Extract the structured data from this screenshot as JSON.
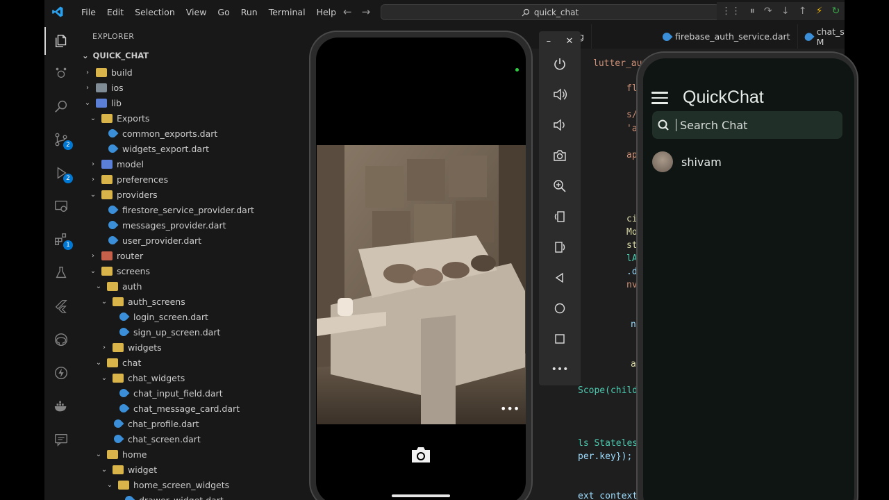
{
  "titlebar": {
    "menu": [
      "File",
      "Edit",
      "Selection",
      "View",
      "Go",
      "Run",
      "Terminal",
      "Help"
    ],
    "command_center": "quick_chat"
  },
  "activity": {
    "scm_badge": "2",
    "debug_badge": "2",
    "extensions_badge": "1"
  },
  "explorer": {
    "title": "EXPLORER",
    "project": "QUICK_CHAT",
    "items": [
      {
        "label": "build",
        "depth": 0,
        "type": "folder",
        "open": false,
        "color": "#d9b44a"
      },
      {
        "label": "ios",
        "depth": 0,
        "type": "folder",
        "open": false,
        "color": "#7f8b95"
      },
      {
        "label": "lib",
        "depth": 0,
        "type": "folder",
        "open": true,
        "color": "#5b7fd6"
      },
      {
        "label": "Exports",
        "depth": 1,
        "type": "folder",
        "open": true,
        "color": "#d9b44a"
      },
      {
        "label": "common_exports.dart",
        "depth": 2,
        "type": "dart"
      },
      {
        "label": "widgets_export.dart",
        "depth": 2,
        "type": "dart"
      },
      {
        "label": "model",
        "depth": 1,
        "type": "folder",
        "open": false,
        "color": "#5b7fd6"
      },
      {
        "label": "preferences",
        "depth": 1,
        "type": "folder",
        "open": false,
        "color": "#d9b44a"
      },
      {
        "label": "providers",
        "depth": 1,
        "type": "folder",
        "open": true,
        "color": "#d9b44a"
      },
      {
        "label": "firestore_service_provider.dart",
        "depth": 2,
        "type": "dart"
      },
      {
        "label": "messages_provider.dart",
        "depth": 2,
        "type": "dart"
      },
      {
        "label": "user_provider.dart",
        "depth": 2,
        "type": "dart"
      },
      {
        "label": "router",
        "depth": 1,
        "type": "folder",
        "open": false,
        "color": "#c5604a"
      },
      {
        "label": "screens",
        "depth": 1,
        "type": "folder",
        "open": true,
        "color": "#d9b44a"
      },
      {
        "label": "auth",
        "depth": 2,
        "type": "folder",
        "open": true,
        "color": "#d9b44a"
      },
      {
        "label": "auth_screens",
        "depth": 3,
        "type": "folder",
        "open": true,
        "color": "#d9b44a"
      },
      {
        "label": "login_screen.dart",
        "depth": 4,
        "type": "dart"
      },
      {
        "label": "sign_up_screen.dart",
        "depth": 4,
        "type": "dart"
      },
      {
        "label": "widgets",
        "depth": 3,
        "type": "folder",
        "open": false,
        "color": "#d9b44a"
      },
      {
        "label": "chat",
        "depth": 2,
        "type": "folder",
        "open": true,
        "color": "#d9b44a"
      },
      {
        "label": "chat_widgets",
        "depth": 3,
        "type": "folder",
        "open": true,
        "color": "#d9b44a"
      },
      {
        "label": "chat_input_field.dart",
        "depth": 4,
        "type": "dart"
      },
      {
        "label": "chat_message_card.dart",
        "depth": 4,
        "type": "dart"
      },
      {
        "label": "chat_profile.dart",
        "depth": 3,
        "type": "dart"
      },
      {
        "label": "chat_screen.dart",
        "depth": 3,
        "type": "dart"
      },
      {
        "label": "home",
        "depth": 2,
        "type": "folder",
        "open": true,
        "color": "#d9b44a"
      },
      {
        "label": "widget",
        "depth": 3,
        "type": "folder",
        "open": true,
        "color": "#d9b44a"
      },
      {
        "label": "home_screen_widgets",
        "depth": 4,
        "type": "folder",
        "open": true,
        "color": "#d9b44a"
      },
      {
        "label": "drawer_widget.dart",
        "depth": 5,
        "type": "dart"
      }
    ]
  },
  "tabs": [
    {
      "label": "log"
    },
    {
      "label": "firebase_auth_service.dart"
    },
    {
      "label": "chat_screen.dart M"
    }
  ],
  "code_lines": [
    {
      "text": "lutter_auth",
      "cls": "str"
    },
    {
      "text": "flutter_ri",
      "cls": "str"
    },
    {
      "text": "s/common_e",
      "cls": "str"
    },
    {
      "text": "'app_route",
      "cls": "str"
    },
    {
      "text": "app_theme.",
      "cls": "str"
    },
    {
      "text": "cialized()",
      "cls": "yellow"
    },
    {
      "text": "Mode(Syste",
      "cls": "yellow"
    },
    {
      "text": "style(cons",
      "cls": "yellow"
    },
    {
      "text": "lAppColors",
      "cls": "green"
    },
    {
      "text": ".darkGreen",
      "cls": "blue"
    },
    {
      "text": "nv');",
      "cls": "str"
    },
    {
      "text": "ns.current",
      "cls": "blue"
    },
    {
      "text": "ations([De",
      "cls": "yellow"
    },
    {
      "text": "Scope(child: Quick",
      "cls": "green"
    },
    {
      "text": "ls StatelessWidget",
      "cls": "green"
    },
    {
      "text": "per.key});",
      "cls": "blue"
    },
    {
      "text": "ext context) {",
      "cls": "blue"
    }
  ],
  "emulator": {
    "toolbar_buttons": [
      "power",
      "volume-up",
      "volume-down",
      "screenshot",
      "zoom",
      "rotate-left",
      "rotate-right",
      "back",
      "home",
      "overview",
      "more"
    ]
  },
  "app": {
    "title": "QuickChat",
    "search_placeholder": "Search Chat",
    "contacts": [
      {
        "name": "shivam"
      }
    ]
  },
  "colors": {
    "accent": "#0078d4",
    "app_bg": "#0e1512",
    "search_bg": "#203029"
  }
}
